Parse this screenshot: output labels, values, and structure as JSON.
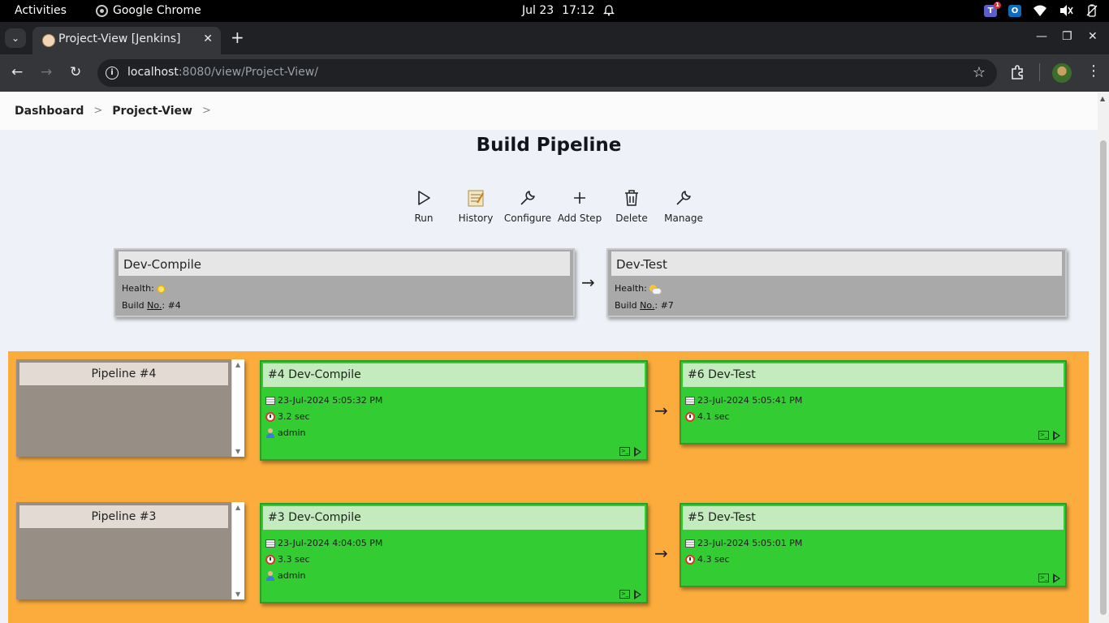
{
  "os": {
    "activities": "Activities",
    "app_name": "Google Chrome",
    "date": "Jul 23",
    "time": "17:12",
    "teams_badge": "1"
  },
  "browser": {
    "tab_title": "Project-View [Jenkins]",
    "url_host": "localhost",
    "url_path": ":8080/view/Project-View/"
  },
  "breadcrumbs": [
    "Dashboard",
    "Project-View"
  ],
  "page": {
    "title": "Build Pipeline"
  },
  "toolbar": [
    {
      "label": "Run",
      "icon": "play-icon"
    },
    {
      "label": "History",
      "icon": "notepad-icon"
    },
    {
      "label": "Configure",
      "icon": "wrench-icon"
    },
    {
      "label": "Add Step",
      "icon": "plus-icon"
    },
    {
      "label": "Delete",
      "icon": "trash-icon"
    },
    {
      "label": "Manage",
      "icon": "wrench-icon"
    }
  ],
  "jobs": [
    {
      "name": "Dev-Compile",
      "health_label": "Health:",
      "build_label_prefix": "Build ",
      "build_label_abbr": "No.",
      "build_label_suffix": ":",
      "build_no": "#4",
      "health_icon": "sunny-icon"
    },
    {
      "name": "Dev-Test",
      "health_label": "Health:",
      "build_label_prefix": "Build ",
      "build_label_abbr": "No.",
      "build_label_suffix": ":",
      "build_no": "#7",
      "health_icon": "partly-sunny-icon"
    }
  ],
  "pipelines": [
    {
      "label": "Pipeline #4",
      "builds": [
        {
          "title": "#4 Dev-Compile",
          "date": "23-Jul-2024 5:05:32 PM",
          "duration": "3.2 sec",
          "user": "admin",
          "status_color": "#33cc33"
        },
        {
          "title": "#6 Dev-Test",
          "date": "23-Jul-2024 5:05:41 PM",
          "duration": "4.1 sec",
          "status_color": "#33cc33"
        }
      ]
    },
    {
      "label": "Pipeline #3",
      "builds": [
        {
          "title": "#3 Dev-Compile",
          "date": "23-Jul-2024 4:04:05 PM",
          "duration": "3.3 sec",
          "user": "admin",
          "status_color": "#33cc33"
        },
        {
          "title": "#5 Dev-Test",
          "date": "23-Jul-2024 5:05:01 PM",
          "duration": "4.3 sec",
          "status_color": "#33cc33"
        }
      ]
    }
  ],
  "colors": {
    "pipeline_area": "#fbac3c",
    "success": "#33cc33",
    "success_header": "#c3ebbd"
  }
}
